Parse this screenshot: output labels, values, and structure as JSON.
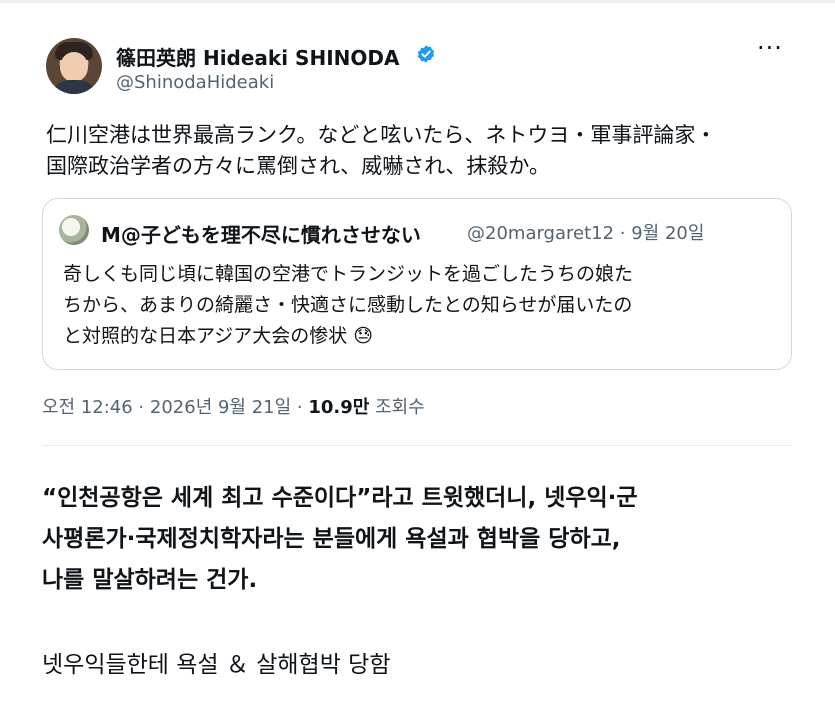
{
  "header": {
    "name": "篠田英朗 Hideaki SHINODA",
    "handle": "@ShinodaHideaki",
    "verified_icon": "verified-badge-icon",
    "more_icon": "more-dots-icon",
    "more_label": "···"
  },
  "tweet": {
    "text": "仁川空港は世界最高ランク。などと呟いたら、ネトウヨ・軍事評論家・\n国際政治学者の方々に罵倒され、威嚇され、抹殺か。"
  },
  "quote": {
    "name": "M@子どもを理不尽に慣れさせない",
    "meta": "@20margaret12 · 9월 20일",
    "text": "奇しくも同じ頃に韓国の空港でトランジットを過ごしたうちの娘た\nちから、あまりの綺麗さ・快適さに感動したとの知らせが届いたの\nと対照的な日本アジア大会の惨状 😓"
  },
  "meta": {
    "time": "오전 12:46 · 2026년 9월 21일 · ",
    "views": "10.9만",
    "views_label": " 조회수"
  },
  "caption": {
    "bold_text": "“인천공항은 세계 최고 수준이다”라고 트윗했더니, 넷우익·군\n사평론가·국제정치학자라는 분들에게 욕설과 협박을 당하고,\n나를 말살하려는 건가.",
    "summary": "넷우익들한테 욕설 ＆ 살해협박 당함"
  },
  "colors": {
    "verified": "#1d9bf0",
    "secondary_text": "#536471",
    "border": "#cfd9de"
  }
}
